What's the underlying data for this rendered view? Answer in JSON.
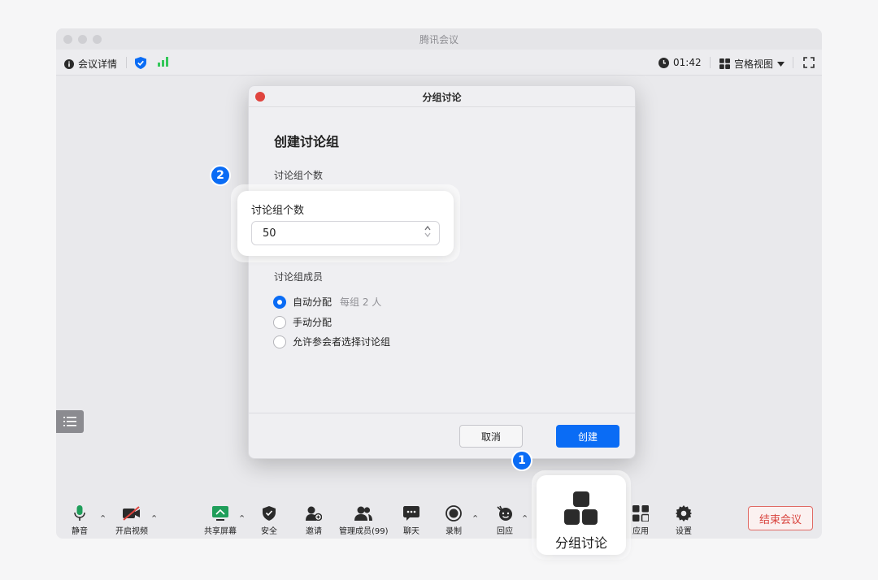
{
  "window": {
    "title": "腾讯会议"
  },
  "topbar": {
    "meeting_info_label": "会议详情",
    "timer": "01:42",
    "view_label": "宫格视图"
  },
  "dialog": {
    "title": "分组讨论",
    "heading": "创建讨论组",
    "group_count_label": "讨论组个数",
    "members_label": "讨论组成员",
    "options": [
      {
        "label": "自动分配",
        "hint": "每组 2 人",
        "checked": true
      },
      {
        "label": "手动分配",
        "checked": false
      },
      {
        "label": "允许参会者选择讨论组",
        "checked": false
      }
    ],
    "cancel_label": "取消",
    "create_label": "创建"
  },
  "callout": {
    "label": "讨论组个数",
    "value": "50"
  },
  "badges": {
    "step1": "1",
    "step2": "2"
  },
  "toolbar": {
    "mute": "静音",
    "video": "开启视频",
    "share": "共享屏幕",
    "security": "安全",
    "invite": "邀请",
    "members": "管理成员(99)",
    "chat": "聊天",
    "record": "录制",
    "reaction": "回应",
    "breakout": "分组讨论",
    "apps": "应用",
    "settings": "设置",
    "end": "结束会议"
  },
  "colors": {
    "accent": "#0a6cf5",
    "danger": "#d9443e",
    "signal": "#34c759"
  }
}
